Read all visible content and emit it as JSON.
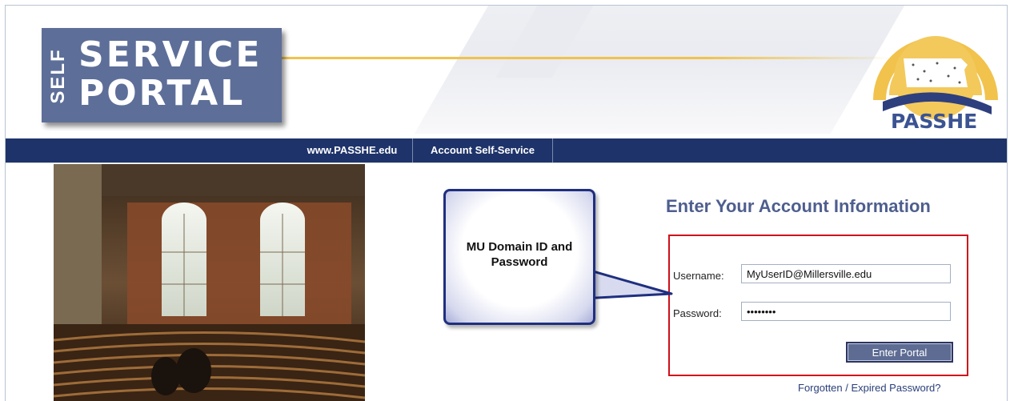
{
  "header": {
    "logo_self": "SELF",
    "logo_line1": "SERVICE",
    "logo_line2": "PORTAL",
    "passhe_logo_text": "PASSHE"
  },
  "nav": {
    "items": [
      {
        "label": "www.PASSHE.edu"
      },
      {
        "label": "Account Self-Service"
      }
    ]
  },
  "callout": {
    "line1": "MU Domain ID and",
    "line2": "Password"
  },
  "form": {
    "title": "Enter Your Account Information",
    "username_label": "Username:",
    "username_value": "MyUserID@Millersville.edu",
    "password_label": "Password:",
    "password_value": "password",
    "submit_label": "Enter Portal",
    "forgot_link": "Forgotten / Expired Password?"
  },
  "colors": {
    "navbar": "#1e336a",
    "accent_gold": "#f1c24c",
    "logo_blue": "#5d6e98",
    "title": "#4e5e8e",
    "highlight_red": "#d0101a",
    "callout_border": "#1f2f80"
  }
}
